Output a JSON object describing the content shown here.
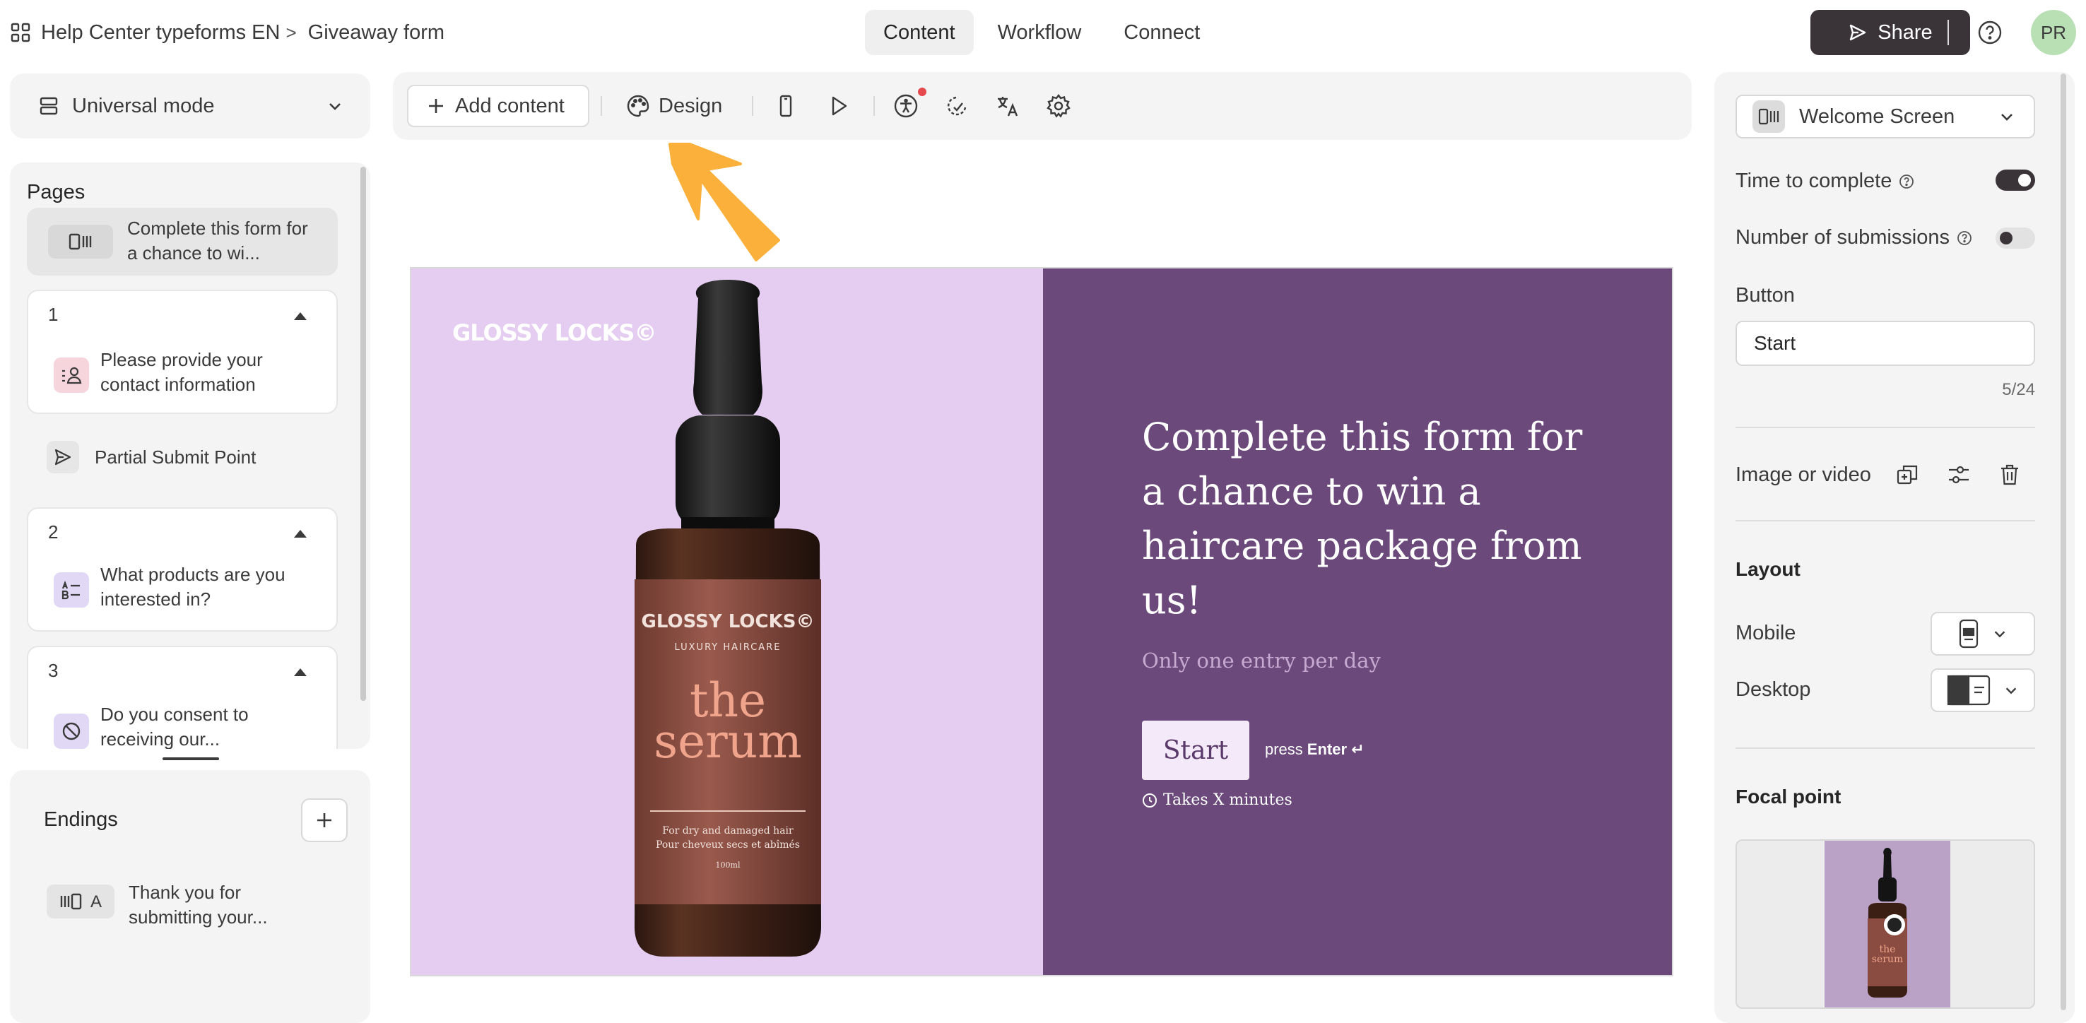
{
  "header": {
    "breadcrumb": {
      "workspace": "Help Center typeforms EN",
      "separator": ">",
      "form": "Giveaway form"
    },
    "tabs": [
      {
        "label": "Content",
        "active": true
      },
      {
        "label": "Workflow",
        "active": false
      },
      {
        "label": "Connect",
        "active": false
      }
    ],
    "share_label": "Share",
    "avatar_initials": "PR"
  },
  "sidebar": {
    "mode_label": "Universal mode",
    "pages_title": "Pages",
    "welcome_item": "Complete this form for a chance to wi...",
    "groups": [
      {
        "number": "1",
        "item": "Please provide your contact information"
      },
      {
        "number": "2",
        "item": "What products are you interested in?"
      },
      {
        "number": "3",
        "item": "Do you consent to receiving our..."
      }
    ],
    "partial_submit_label": "Partial Submit Point",
    "endings_title": "Endings",
    "ending_item": "Thank you for submitting your...",
    "ending_badge": "A"
  },
  "toolbar": {
    "add_content_label": "Add content",
    "design_label": "Design"
  },
  "preview": {
    "brand": "GLOSSY LOCKS©",
    "bottle_brand": "GLOSSY LOCKS©",
    "bottle_tagline": "LUXURY HAIRCARE",
    "bottle_word_1": "the",
    "bottle_word_2": "serum",
    "bottle_line_1": "For dry and damaged hair",
    "bottle_line_2": "Pour cheveux secs et abîmés",
    "bottle_volume": "100ml",
    "headline": "Complete this form for a chance to win a haircare package from us!",
    "subline": "Only one entry per day",
    "button_label": "Start",
    "press_label": "press",
    "enter_label": "Enter ↵",
    "time_label": "Takes X minutes",
    "colors": {
      "left_bg": "#e4cdf0",
      "right_bg": "#6b497b"
    }
  },
  "settings": {
    "screen_type": "Welcome Screen",
    "time_to_complete_label": "Time to complete",
    "time_to_complete_on": true,
    "submissions_label": "Number of submissions",
    "submissions_on": false,
    "button_section_label": "Button",
    "button_value": "Start",
    "button_counter": "5/24",
    "media_label": "Image or video",
    "layout_title": "Layout",
    "mobile_label": "Mobile",
    "desktop_label": "Desktop",
    "focal_title": "Focal point"
  }
}
